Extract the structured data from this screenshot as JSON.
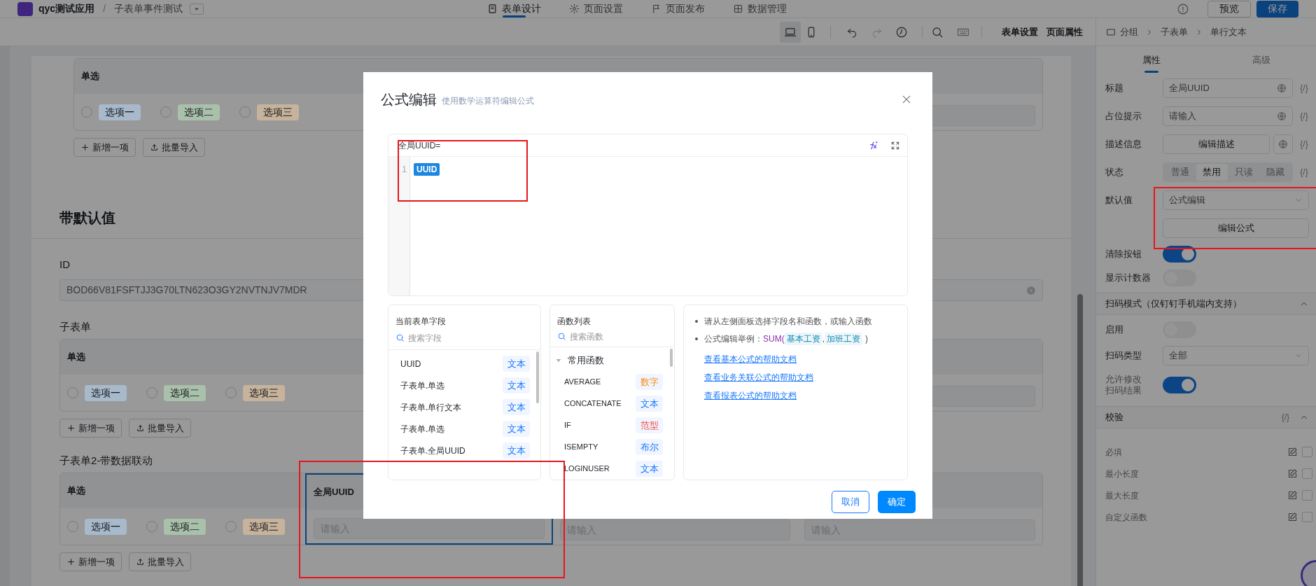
{
  "header": {
    "app_name": "qyc测试应用",
    "separator": "/",
    "page_name": "子表单事件测试",
    "tabs": [
      {
        "label": "表单设计",
        "selected": true
      },
      {
        "label": "页面设置",
        "selected": false
      },
      {
        "label": "页面发布",
        "selected": false
      },
      {
        "label": "数据管理",
        "selected": false
      }
    ],
    "buttons": [
      {
        "label": "预览",
        "kind": "default"
      },
      {
        "label": "保存",
        "kind": "primary"
      }
    ]
  },
  "toolbar": {
    "devices": [
      {
        "kind": "desktop",
        "selected": true
      },
      {
        "kind": "mobile",
        "selected": false
      }
    ],
    "history": [
      {
        "kind": "undo",
        "disabled": false
      },
      {
        "kind": "redo",
        "disabled": true
      }
    ],
    "links": [
      "表单设置",
      "页面属性"
    ]
  },
  "canvas": {
    "blocks": [
      {
        "kind": "subtable",
        "indent": true,
        "columns": [
          {
            "kind": "radio",
            "header": "单选",
            "options": [
              {
                "label": "选项一",
                "color": "#a7b9cb"
              },
              {
                "label": "选项二",
                "color": "#a9c0ab"
              },
              {
                "label": "选项三",
                "color": "#c7b39c"
              }
            ]
          },
          {
            "kind": "blank"
          },
          {
            "kind": "blank"
          },
          {
            "kind": "input"
          }
        ],
        "actions": [
          "新增一项",
          "批量导入"
        ]
      },
      {
        "kind": "heading",
        "text": "带默认值"
      },
      {
        "kind": "field",
        "label": "ID",
        "value": "BOD66V81FSFTJJ3G70LTN623O3GY2NVTNJV7MDR"
      },
      {
        "kind": "subtable",
        "indent": false,
        "label": "子表单",
        "columns": [
          {
            "kind": "radio",
            "header": "单选",
            "options": [
              {
                "label": "选项一",
                "color": "#a7b9cb"
              },
              {
                "label": "选项二",
                "color": "#a9c0ab"
              },
              {
                "label": "选项三",
                "color": "#c7b39c"
              }
            ]
          },
          {
            "kind": "blank"
          },
          {
            "kind": "blank"
          },
          {
            "kind": "input"
          }
        ],
        "actions": [
          "新增一项",
          "批量导入"
        ]
      },
      {
        "kind": "subtable",
        "indent": false,
        "label": "子表单2-带数据联动",
        "columns": [
          {
            "kind": "radio",
            "header": "单选",
            "selected": false,
            "options": [
              {
                "label": "选项一",
                "color": "#a7b9cb"
              },
              {
                "label": "选项二",
                "color": "#a9c0ab"
              },
              {
                "label": "选项三",
                "color": "#c7b39c"
              }
            ]
          },
          {
            "kind": "input",
            "header": "全局UUID",
            "placeholder": "请输入",
            "selected": true
          },
          {
            "kind": "input",
            "placeholder": "请输入",
            "selected": false
          },
          {
            "kind": "input",
            "placeholder": "请输入",
            "selected": false
          }
        ],
        "actions": [
          "新增一项",
          "批量导入"
        ]
      }
    ]
  },
  "properties": {
    "breadcrumb": [
      "分组",
      "子表单",
      "单行文本"
    ],
    "tabs": [
      {
        "label": "属性",
        "selected": true
      },
      {
        "label": "高级",
        "selected": false
      }
    ],
    "rows": [
      {
        "kind": "input",
        "label": "标题",
        "value": "全局UUID",
        "variable": "{/}"
      },
      {
        "kind": "input",
        "label": "占位提示",
        "value": "请输入",
        "variable": "{/}"
      },
      {
        "kind": "button",
        "label": "描述信息",
        "button": "编辑描述",
        "variable": "{/}"
      },
      {
        "kind": "segmented",
        "label": "状态",
        "variable": "{/}",
        "options": [
          {
            "label": "普通",
            "selected": false
          },
          {
            "label": "禁用",
            "selected": true
          },
          {
            "label": "只读",
            "selected": false
          },
          {
            "label": "隐藏",
            "selected": false
          }
        ]
      },
      {
        "kind": "select",
        "label": "默认值",
        "value": "公式编辑"
      },
      {
        "kind": "action",
        "button": "编辑公式"
      },
      {
        "kind": "toggle",
        "label": "清除按钮",
        "on": true
      },
      {
        "kind": "toggle",
        "label": "显示计数器",
        "on": false
      },
      {
        "kind": "section",
        "title": "扫码模式（仅钉钉手机端内支持）",
        "expanded": true
      },
      {
        "kind": "toggle",
        "label": "启用",
        "on": false
      },
      {
        "kind": "select",
        "label": "扫码类型",
        "value": "全部"
      },
      {
        "kind": "toggle",
        "label_lines": [
          "允许修改",
          "扫码结果"
        ],
        "on": true
      },
      {
        "kind": "section",
        "title": "校验",
        "variable": "{/}",
        "expanded": true
      },
      {
        "kind": "check",
        "label": "必填",
        "checked": false
      },
      {
        "kind": "check",
        "label": "最小长度",
        "checked": false
      },
      {
        "kind": "check",
        "label": "最大长度",
        "checked": false
      },
      {
        "kind": "check",
        "label": "自定义函数",
        "checked": false
      }
    ]
  },
  "dialog": {
    "title": "公式编辑",
    "subtitle": "使用数学运算符编辑公式",
    "editor": {
      "label": "全局UUID=",
      "lines": [
        {
          "number": "1",
          "tokens": [
            {
              "kind": "field",
              "text": "UUID"
            }
          ]
        }
      ]
    },
    "fields": {
      "title": "当前表单字段",
      "search_placeholder": "搜索字段",
      "items": [
        {
          "name": "UUID",
          "type": "文本",
          "color": "#1677ff"
        },
        {
          "name": "子表单.单选",
          "type": "文本",
          "color": "#1677ff"
        },
        {
          "name": "子表单.单行文本",
          "type": "文本",
          "color": "#1677ff"
        },
        {
          "name": "子表单.单选",
          "type": "文本",
          "color": "#1677ff"
        },
        {
          "name": "子表单.全局UUID",
          "type": "文本",
          "color": "#1677ff"
        }
      ]
    },
    "functions": {
      "title": "函数列表",
      "search_placeholder": "搜索函数",
      "groups": [
        {
          "name": "常用函数",
          "expanded": true,
          "items": [
            {
              "name": "AVERAGE",
              "type": "数字",
              "color": "#fa8c16"
            },
            {
              "name": "CONCATENATE",
              "type": "文本",
              "color": "#1677ff"
            },
            {
              "name": "IF",
              "type": "范型",
              "color": "#f5483b"
            },
            {
              "name": "ISEMPTY",
              "type": "布尔",
              "color": "#1677ff"
            },
            {
              "name": "LOGINUSER",
              "type": "文本",
              "color": "#1677ff"
            }
          ]
        }
      ]
    },
    "help": {
      "tips": [
        "请从左侧面板选择字段名和函数，或输入函数"
      ],
      "example": {
        "label": "公式编辑举例：",
        "function": "SUM(",
        "args": [
          "基本工资",
          "加班工资"
        ],
        "separator": ",",
        "close": ")"
      },
      "links": [
        "查看基本公式的帮助文档",
        "查看业务关联公式的帮助文档",
        "查看报表公式的帮助文档"
      ]
    },
    "buttons": [
      {
        "label": "取消",
        "kind": "default"
      },
      {
        "label": "确定",
        "kind": "primary"
      }
    ]
  }
}
